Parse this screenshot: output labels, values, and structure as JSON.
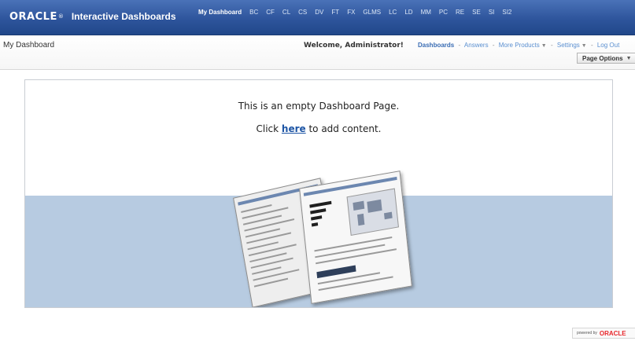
{
  "brand": {
    "logo": "ORACLE",
    "trademark": "®",
    "product": "Interactive Dashboards"
  },
  "tabs": [
    {
      "label": "My Dashboard",
      "active": true
    },
    {
      "label": "BC"
    },
    {
      "label": "CF"
    },
    {
      "label": "CL"
    },
    {
      "label": "CS"
    },
    {
      "label": "DV"
    },
    {
      "label": "FT"
    },
    {
      "label": "FX"
    },
    {
      "label": "GLMS"
    },
    {
      "label": "LC"
    },
    {
      "label": "LD"
    },
    {
      "label": "MM"
    },
    {
      "label": "PC"
    },
    {
      "label": "RE"
    },
    {
      "label": "SE"
    },
    {
      "label": "SI"
    },
    {
      "label": "SI2"
    }
  ],
  "header": {
    "page_title": "My Dashboard",
    "welcome": "Welcome, Administrator!",
    "links": {
      "dashboards": "Dashboards",
      "answers": "Answers",
      "more_products": "More Products",
      "settings": "Settings",
      "logout": "Log Out",
      "separator": "-",
      "caret": "▼"
    },
    "page_options": "Page Options"
  },
  "content": {
    "empty_message": "This is an empty Dashboard Page.",
    "add_prefix": "Click ",
    "add_link": "here",
    "add_suffix": " to add content."
  },
  "footer": {
    "powered_by": "powered by",
    "vendor": "ORACLE"
  },
  "colors": {
    "topbar": "#2e559c",
    "link": "#5a8fd0",
    "band": "#b7cbe1",
    "oracle_red": "#e8262b"
  }
}
